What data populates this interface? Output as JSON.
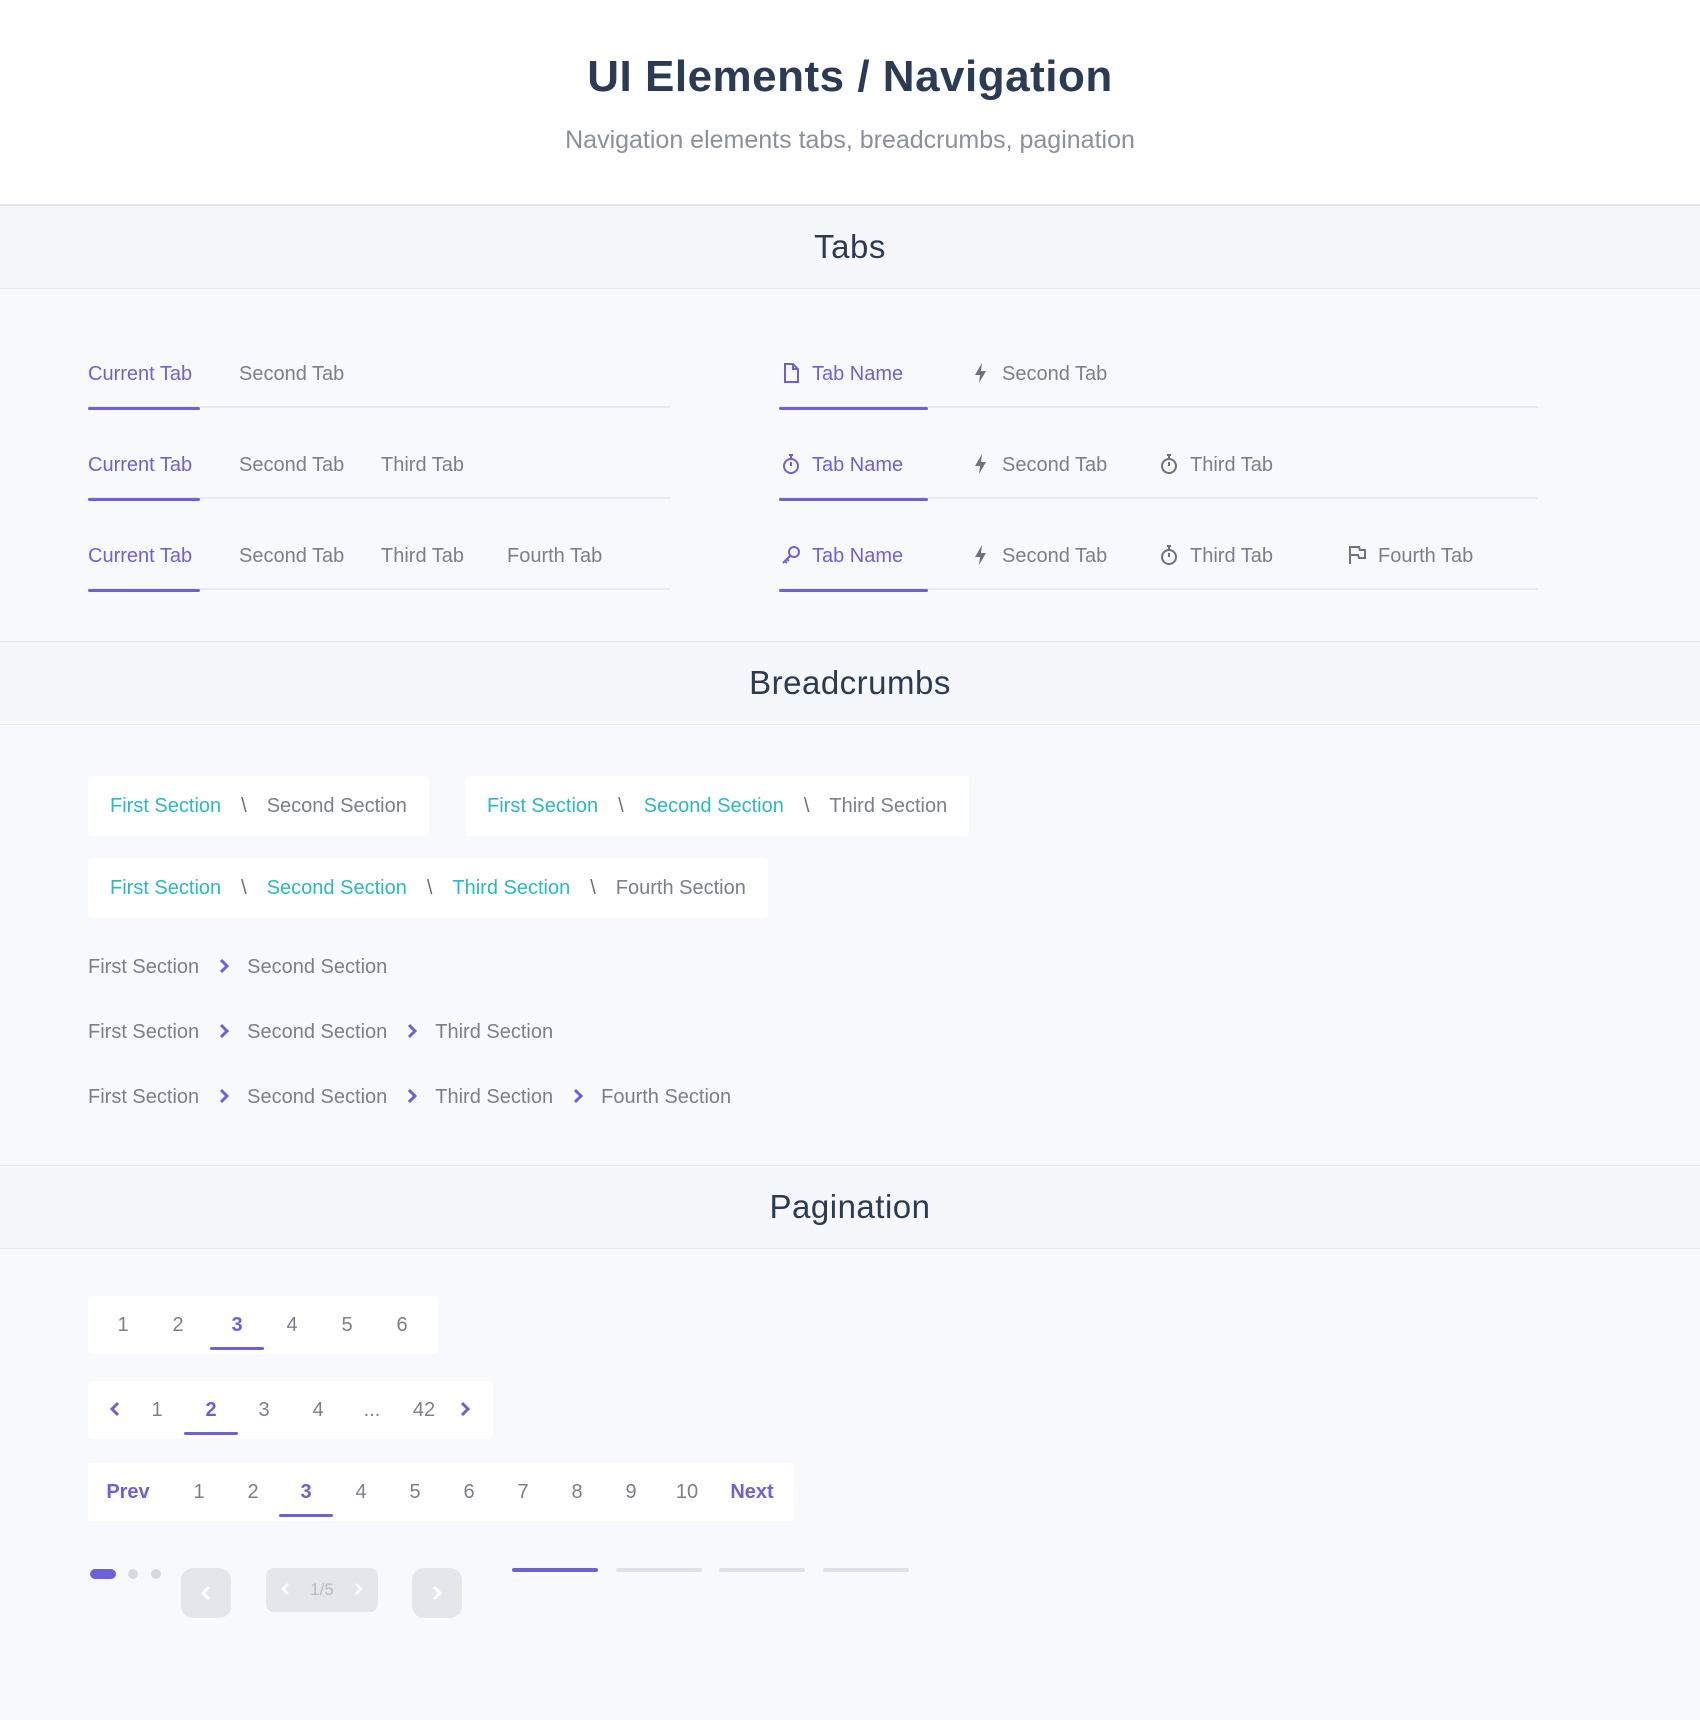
{
  "header": {
    "title": "UI Elements / Navigation",
    "subtitle": "Navigation elements tabs, breadcrumbs, pagination"
  },
  "sections": {
    "tabs": "Tabs",
    "breadcrumbs": "Breadcrumbs",
    "pagination": "Pagination"
  },
  "colors": {
    "accent": "#6c61d9",
    "link": "#2bb8c0",
    "text": "#7a7f8c",
    "heading": "#2b3a55"
  },
  "tabs_plain": [
    [
      "Current Tab",
      "Second Tab"
    ],
    [
      "Current Tab",
      "Second Tab",
      "Third Tab"
    ],
    [
      "Current Tab",
      "Second Tab",
      "Third Tab",
      "Fourth Tab"
    ]
  ],
  "tabs_icon": [
    [
      {
        "label": "Tab Name",
        "icon": "document-icon"
      },
      {
        "label": "Second Tab",
        "icon": "lightning-icon"
      }
    ],
    [
      {
        "label": "Tab Name",
        "icon": "stopwatch-icon"
      },
      {
        "label": "Second Tab",
        "icon": "lightning-icon"
      },
      {
        "label": "Third Tab",
        "icon": "stopwatch-icon"
      }
    ],
    [
      {
        "label": "Tab Name",
        "icon": "key-icon"
      },
      {
        "label": "Second Tab",
        "icon": "lightning-icon"
      },
      {
        "label": "Third Tab",
        "icon": "stopwatch-icon"
      },
      {
        "label": "Fourth Tab",
        "icon": "flag-icon"
      }
    ]
  ],
  "breadcrumbs_boxed": [
    [
      "First Section",
      "Second Section"
    ],
    [
      "First Section",
      "Second Section",
      "Third Section"
    ],
    [
      "First Section",
      "Second Section",
      "Third Section",
      "Fourth Section"
    ]
  ],
  "breadcrumb_separator": "\\",
  "breadcrumbs_chevron": [
    [
      "First Section",
      "Second Section"
    ],
    [
      "First Section",
      "Second Section",
      "Third Section"
    ],
    [
      "First Section",
      "Second Section",
      "Third Section",
      "Fourth Section"
    ]
  ],
  "pagination": {
    "simple": {
      "pages": [
        "1",
        "2",
        "3",
        "4",
        "5",
        "6"
      ],
      "current": "3"
    },
    "arrows": {
      "pages": [
        "1",
        "2",
        "3",
        "4",
        "...",
        "42"
      ],
      "current": "2"
    },
    "prevnext": {
      "prev": "Prev",
      "next": "Next",
      "pages": [
        "1",
        "2",
        "3",
        "4",
        "5",
        "6",
        "7",
        "8",
        "9",
        "10"
      ],
      "current": "3"
    },
    "dots": {
      "count": 3,
      "current": 1
    },
    "counter": "1/5",
    "bars": {
      "count": 4,
      "current": 1
    }
  }
}
